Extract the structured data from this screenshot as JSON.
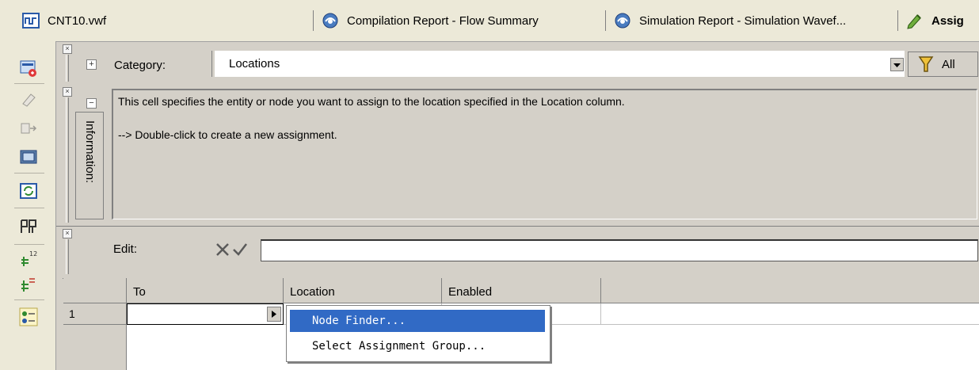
{
  "tabs": [
    {
      "label": "CNT10.vwf",
      "icon": "waveform-file-icon"
    },
    {
      "label": "Compilation Report - Flow Summary",
      "icon": "report-icon"
    },
    {
      "label": "Simulation Report - Simulation Wavef...",
      "icon": "report-icon"
    },
    {
      "label": "Assig",
      "icon": "assignment-editor-icon"
    }
  ],
  "left_toolbar": {
    "icons": [
      "assignment-editor-icon",
      "eraser-icon",
      "pin-arrow-icon",
      "chip-icon",
      "refresh-chip-icon",
      "pin-planner-icon",
      "bus-numbered-icon",
      "bus-icon",
      "node-group-icon"
    ]
  },
  "category": {
    "label": "Category:",
    "value": "Locations",
    "all_label": "All"
  },
  "information": {
    "label": "Information:",
    "line1": "This cell specifies the entity or node you want to assign to the location specified in the Location column.",
    "line2": "--> Double-click to create a new assignment."
  },
  "edit": {
    "label": "Edit:",
    "value": ""
  },
  "table": {
    "columns": [
      "To",
      "Location",
      "Enabled"
    ],
    "rows": [
      {
        "index": "1",
        "to": "",
        "location": "",
        "enabled": ""
      }
    ]
  },
  "context_menu": {
    "items": [
      "Node Finder...",
      "Select Assignment Group..."
    ],
    "selected_index": 0
  },
  "colors": {
    "selection": "#316ac5",
    "panel": "#d4d0c8",
    "toolbar": "#ece9d8"
  }
}
